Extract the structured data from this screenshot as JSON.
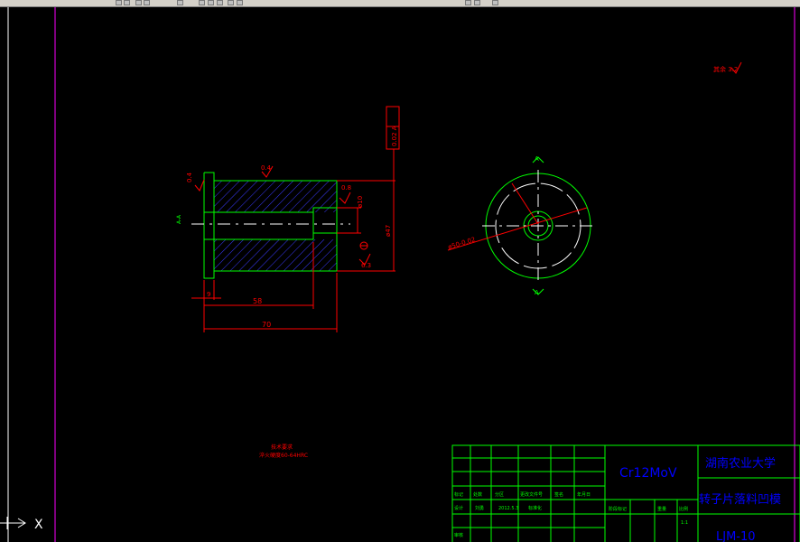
{
  "ucs": {
    "x_label": "X"
  },
  "side_view": {
    "surface_finish_top": "0.4",
    "surface_finish_left": "0.4",
    "surface_finish_right_top": "0.8",
    "surface_finish_right_bottom": "6.3",
    "dia_small": "ø10",
    "dia_large": "ø47",
    "tolerance_frame": "0.02 A",
    "dim_small": "9",
    "dim_mid": "58",
    "dim_total": "70",
    "datum_mark": "A-A"
  },
  "end_view": {
    "dia_outer": "ø50-0.02",
    "section_top": "A",
    "section_bottom": "A"
  },
  "other_finish": "其余 3.2",
  "tech_notes": {
    "title": "技术要求",
    "line1": "淬火硬度60-64HRC"
  },
  "title_block": {
    "material": "Cr12MoV",
    "school": "湖南农业大学",
    "part_name": "转子片落料凹模",
    "drawing_no": "LJM-10",
    "row_labels": [
      "标记",
      "处数",
      "分区",
      "更改文件号",
      "签名",
      "年月日"
    ],
    "design_row": [
      "设计",
      "刘勇",
      "2012.5.3",
      "标准化"
    ],
    "stage_labels": [
      "阶段标记",
      "重量",
      "比例"
    ],
    "scale": "1:1",
    "review": "审核"
  }
}
